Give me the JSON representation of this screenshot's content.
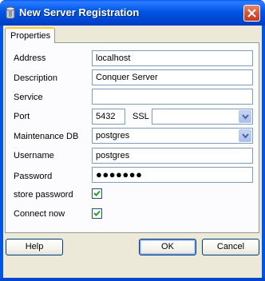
{
  "window": {
    "title": "New Server Registration"
  },
  "tabs": [
    {
      "label": "Properties"
    }
  ],
  "form": {
    "address": {
      "label": "Address",
      "value": "localhost"
    },
    "description": {
      "label": "Description",
      "value": "Conquer Server"
    },
    "service": {
      "label": "Service",
      "value": ""
    },
    "port": {
      "label": "Port",
      "value": "5432"
    },
    "ssl": {
      "label": "SSL",
      "value": ""
    },
    "maintenance_db": {
      "label": "Maintenance DB",
      "value": "postgres"
    },
    "username": {
      "label": "Username",
      "value": "postgres"
    },
    "password": {
      "label": "Password",
      "masked_value": "●●●●●●●"
    },
    "store_password": {
      "label": "store password",
      "checked": true
    },
    "connect_now": {
      "label": "Connect now",
      "checked": true
    }
  },
  "buttons": {
    "help": "Help",
    "ok": "OK",
    "cancel": "Cancel"
  },
  "colors": {
    "titlebar": "#0055e5",
    "dialog_background": "#ece9d8",
    "field_border": "#7f9db9",
    "checkmark": "#21a121"
  }
}
